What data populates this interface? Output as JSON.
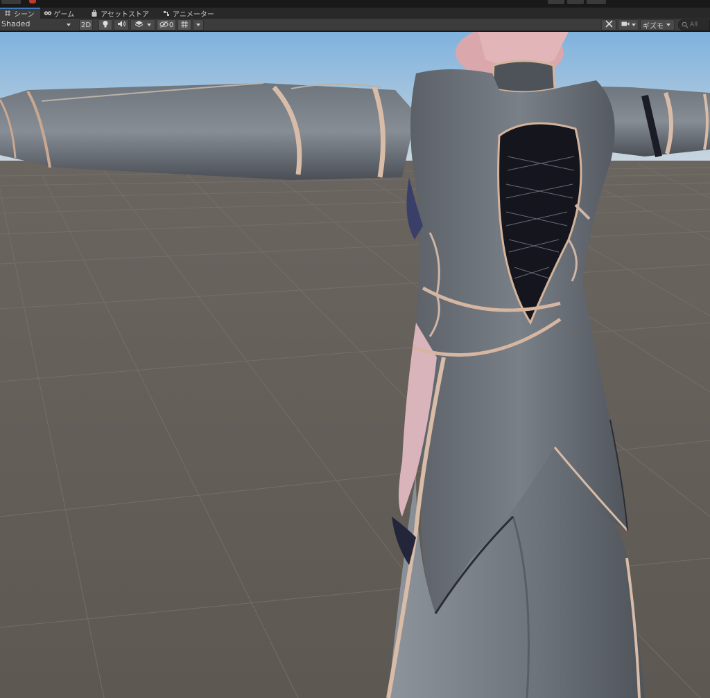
{
  "tabs": [
    {
      "label": "シーン",
      "icon": "grid-icon",
      "active": true
    },
    {
      "label": "ゲーム",
      "icon": "gamepad-icon",
      "active": false
    },
    {
      "label": "アセットストア",
      "icon": "shopping-bag-icon",
      "active": false
    },
    {
      "label": "アニメーター",
      "icon": "animator-icon",
      "active": false
    }
  ],
  "toolbar": {
    "shading_mode": "Shaded",
    "mode_2d": "2D",
    "hidden_count": "0",
    "gizmos_label": "ギズモ",
    "search_placeholder": "All"
  },
  "icons": {
    "lighting": "lightbulb-icon",
    "audio": "speaker-icon",
    "effects": "layers-icon",
    "visibility": "eye-slash-icon",
    "grid_toggle": "grid-snap-icon",
    "tools": "tools-icon",
    "camera": "camera-icon",
    "search": "search-icon"
  },
  "colors": {
    "accent": "#3a79bb",
    "sky": "#a8cbe8",
    "ground": "#5f5954"
  }
}
